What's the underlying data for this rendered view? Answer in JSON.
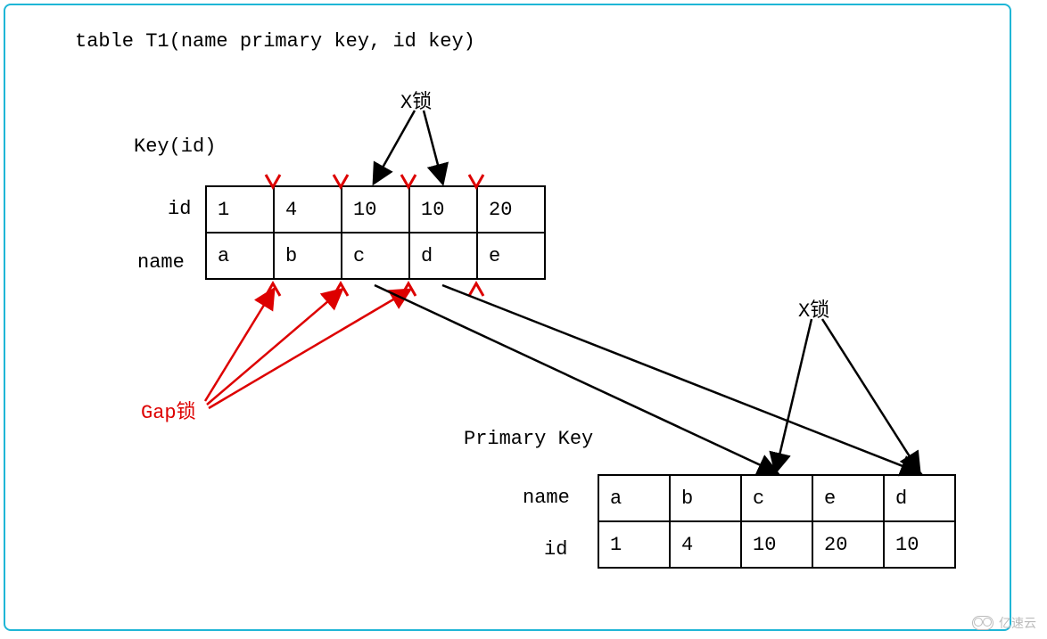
{
  "title": "table T1(name primary key, id key)",
  "labels": {
    "x_lock": "X锁",
    "gap_lock": "Gap锁",
    "key_id": "Key(id)",
    "primary_key": "Primary Key",
    "id": "id",
    "name": "name"
  },
  "key_table": {
    "rows": [
      {
        "label": "id",
        "cells": [
          "1",
          "4",
          "10",
          "10",
          "20"
        ]
      },
      {
        "label": "name",
        "cells": [
          "a",
          "b",
          "c",
          "d",
          "e"
        ]
      }
    ]
  },
  "primary_key_table": {
    "rows": [
      {
        "label": "name",
        "cells": [
          "a",
          "b",
          "c",
          "e",
          "d"
        ]
      },
      {
        "label": "id",
        "cells": [
          "1",
          "4",
          "10",
          "20",
          "10"
        ]
      }
    ]
  },
  "annotations": {
    "x_lock_key_targets_note": "X lock on id=10 entries (columns 3 and 4 of Key(id) index)",
    "gap_lock_targets_note": "Gap locks on gaps before column 2, 3, 4 of Key(id) index",
    "x_lock_pk_targets_note": "X lock on primary-key rows name=c (id 10) and name=d (id 10)"
  },
  "watermark": "亿速云"
}
